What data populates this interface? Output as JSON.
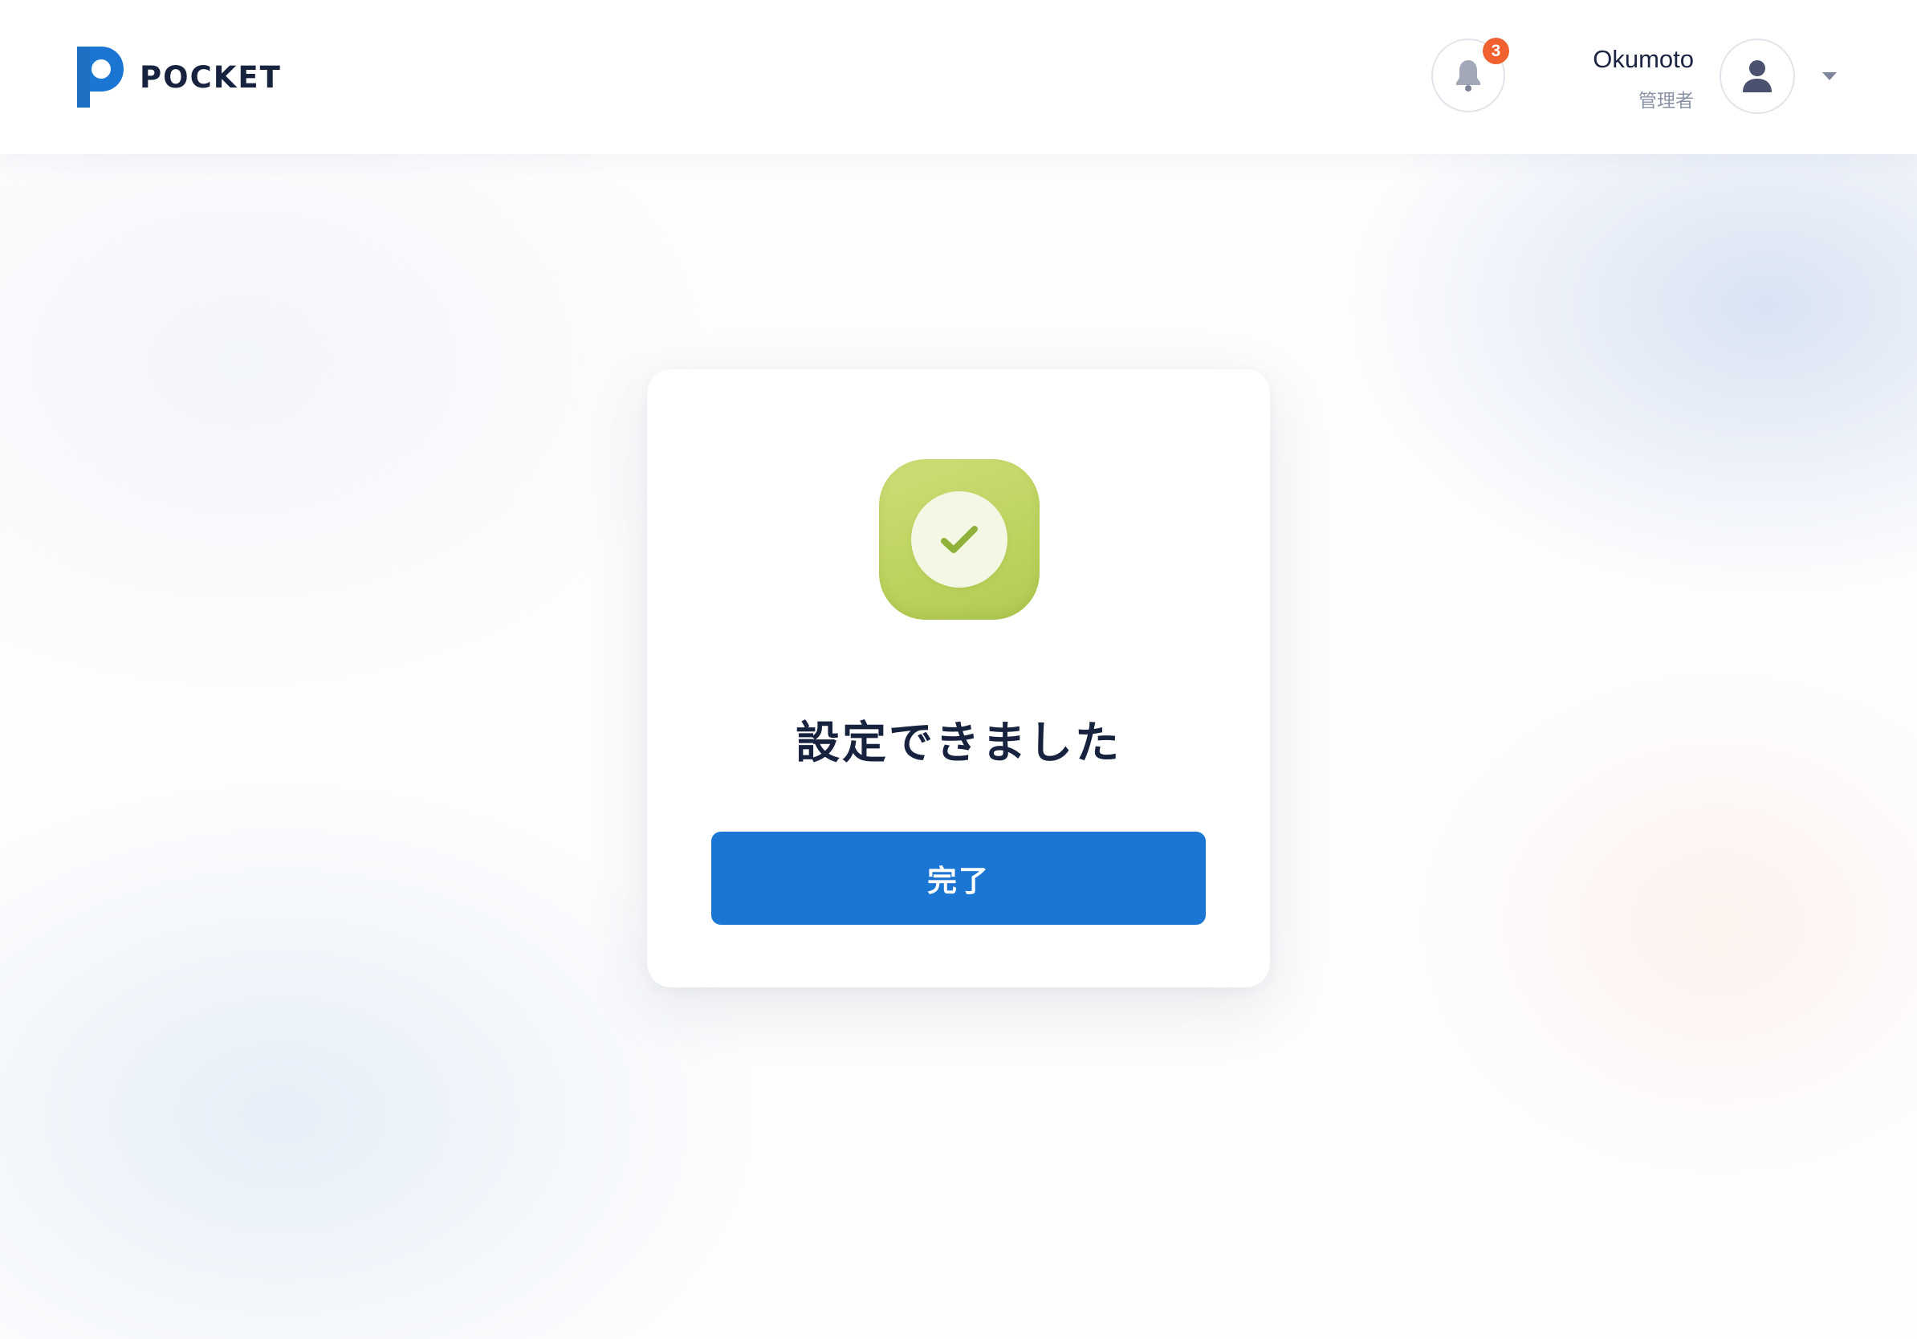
{
  "header": {
    "brand": "POCKET",
    "brand_color": "#1a76d2",
    "notifications": {
      "icon": "bell-icon",
      "count": "3",
      "badge_color": "#f0612f"
    },
    "user": {
      "name": "Okumoto",
      "role": "管理者",
      "avatar_icon": "user-icon",
      "menu_icon": "caret-down-icon"
    }
  },
  "card": {
    "icon": "check-circle-icon",
    "icon_color": "#c2d765",
    "title": "設定できました",
    "button_label": "完了",
    "button_color": "#1a76d2"
  }
}
